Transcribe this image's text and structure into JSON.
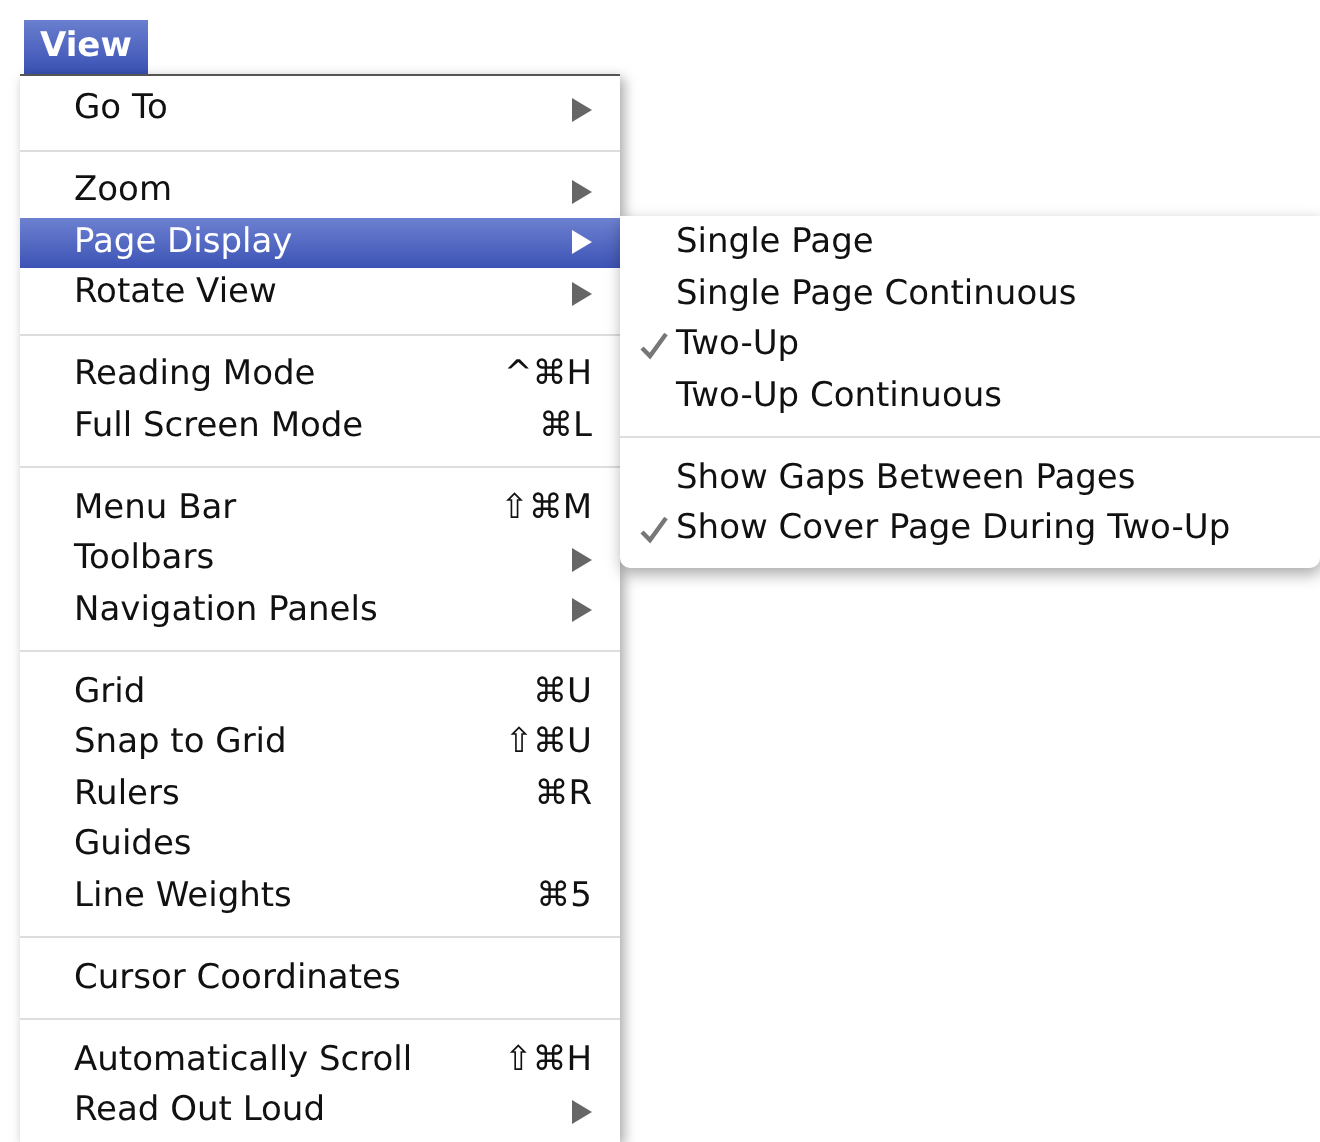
{
  "menu_title": "View",
  "menu": {
    "groups": [
      [
        {
          "label": "Go To",
          "has_submenu": true,
          "selected": false
        }
      ],
      [
        {
          "label": "Zoom",
          "has_submenu": true,
          "selected": false
        },
        {
          "label": "Page Display",
          "has_submenu": true,
          "selected": true
        },
        {
          "label": "Rotate View",
          "has_submenu": true,
          "selected": false
        }
      ],
      [
        {
          "label": "Reading Mode",
          "shortcut": "^⌘H",
          "selected": false
        },
        {
          "label": "Full Screen Mode",
          "shortcut": "⌘L",
          "selected": false
        }
      ],
      [
        {
          "label": "Menu Bar",
          "shortcut": "⇧⌘M",
          "selected": false
        },
        {
          "label": "Toolbars",
          "has_submenu": true,
          "selected": false
        },
        {
          "label": "Navigation Panels",
          "has_submenu": true,
          "selected": false
        }
      ],
      [
        {
          "label": "Grid",
          "shortcut": "⌘U",
          "selected": false
        },
        {
          "label": "Snap to Grid",
          "shortcut": "⇧⌘U",
          "selected": false
        },
        {
          "label": "Rulers",
          "shortcut": "⌘R",
          "selected": false
        },
        {
          "label": "Guides",
          "selected": false
        },
        {
          "label": "Line Weights",
          "shortcut": "⌘5",
          "selected": false
        }
      ],
      [
        {
          "label": "Cursor Coordinates",
          "selected": false
        }
      ],
      [
        {
          "label": "Automatically Scroll",
          "shortcut": "⇧⌘H",
          "selected": false
        },
        {
          "label": "Read Out Loud",
          "has_submenu": true,
          "selected": false
        }
      ]
    ]
  },
  "submenu": {
    "groups": [
      [
        {
          "label": "Single Page",
          "checked": false
        },
        {
          "label": "Single Page Continuous",
          "checked": false
        },
        {
          "label": "Two-Up",
          "checked": true
        },
        {
          "label": "Two-Up Continuous",
          "checked": false
        }
      ],
      [
        {
          "label": "Show Gaps Between Pages",
          "checked": false
        },
        {
          "label": "Show Cover Page During Two-Up",
          "checked": true
        }
      ]
    ]
  }
}
